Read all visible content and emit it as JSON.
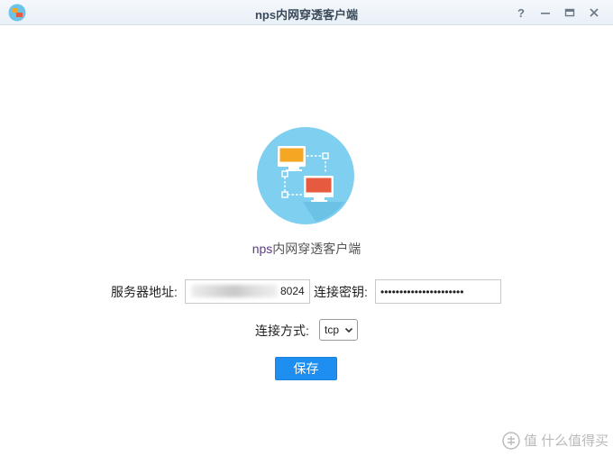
{
  "window": {
    "title": "nps内网穿透客户端",
    "controls": {
      "help": "?",
      "minimize": "—",
      "maximize": "▭",
      "close": "✕"
    }
  },
  "hero": {
    "label_prefix": "nps",
    "label_suffix": "内网穿透客户端"
  },
  "form": {
    "server_label": "服务器地址:",
    "server_value_visible": "8024",
    "key_label": "连接密钥:",
    "key_value": "••••••••••••••••••••••",
    "mode_label": "连接方式:",
    "mode_selected": "tcp",
    "save_label": "保存"
  },
  "watermark": {
    "text": "值 什么值得买"
  },
  "colors": {
    "accent": "#1e8ff0",
    "hero_circle": "#7fd0f0",
    "monitor_orange": "#f5a623",
    "monitor_red": "#e65a3f"
  }
}
